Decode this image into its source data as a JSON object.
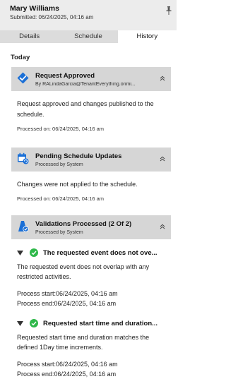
{
  "header": {
    "name": "Mary Williams",
    "submitted": "Submitted: 06/24/2025, 04:16 am"
  },
  "tabs": [
    {
      "label": "Details",
      "active": false
    },
    {
      "label": "Schedule",
      "active": false
    },
    {
      "label": "History",
      "active": true
    }
  ],
  "section_label": "Today",
  "cards": [
    {
      "icon": "check-badge-icon",
      "title": "Request Approved",
      "byline": "By RALindaGarcia@TenantEverything.onmi...",
      "message": "Request approved and changes published to the schedule.",
      "processed": "Processed on:  06/24/2025, 04:16 am"
    },
    {
      "icon": "calendar-sync-icon",
      "title": "Pending Schedule Updates",
      "byline": "Processed by System",
      "message": "Changes were not applied to the schedule.",
      "processed": "Processed on:  06/24/2025, 04:16 am"
    },
    {
      "icon": "validation-icon",
      "title": "Validations Processed (2 Of 2)",
      "byline": "Processed by System",
      "items": [
        {
          "title": "The requested event does not ove...",
          "message": "The requested event does not overlap with any restricted activities.",
          "start": "Process start:06/24/2025, 04:16 am",
          "end": "Process end:06/24/2025, 04:16 am"
        },
        {
          "title": "Requested start time and duration...",
          "message": "Requested start time and duration matches the defined 1Day time increments.",
          "start": "Process start:06/24/2025, 04:16 am",
          "end": "Process end:06/24/2025, 04:16 am"
        }
      ]
    }
  ],
  "colors": {
    "accent": "#1a6fd6",
    "success": "#2fb84a",
    "header_bg": "#ececec",
    "card_head_bg": "#d6d6d6"
  }
}
